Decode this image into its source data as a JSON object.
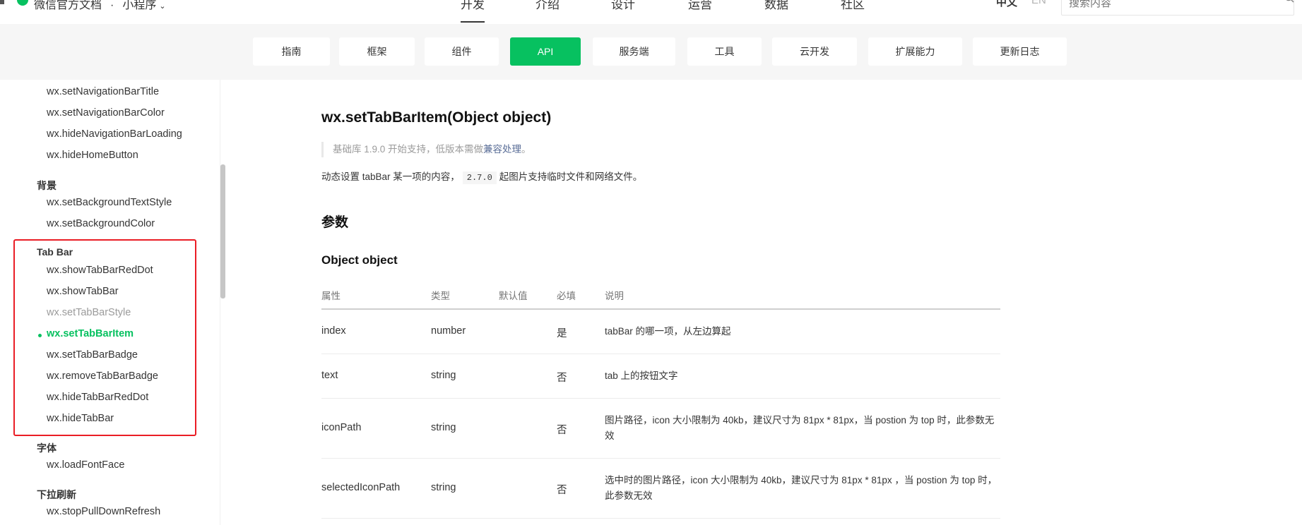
{
  "topbar": {
    "brand": "微信官方文档",
    "separator": "·",
    "product": "小程序",
    "nav": [
      "开发",
      "介绍",
      "设计",
      "运营",
      "数据",
      "社区"
    ],
    "active_nav": "开发",
    "lang_zh": "中文",
    "lang_en": "EN",
    "search_placeholder": "搜索内容"
  },
  "subnav": {
    "items": [
      "指南",
      "框架",
      "组件",
      "API",
      "服务端",
      "工具",
      "云开发",
      "扩展能力",
      "更新日志"
    ],
    "active": "API"
  },
  "sidebar": {
    "items_top": [
      "wx.setNavigationBarTitle",
      "wx.setNavigationBarColor",
      "wx.hideNavigationBarLoading",
      "wx.hideHomeButton"
    ],
    "group_bg": "背景",
    "items_bg": [
      "wx.setBackgroundTextStyle",
      "wx.setBackgroundColor"
    ],
    "group_tabbar": "Tab Bar",
    "items_tabbar": [
      "wx.showTabBarRedDot",
      "wx.showTabBar",
      "wx.setTabBarStyle",
      "wx.setTabBarItem",
      "wx.setTabBarBadge",
      "wx.removeTabBarBadge",
      "wx.hideTabBarRedDot",
      "wx.hideTabBar"
    ],
    "group_font": "字体",
    "items_font": [
      "wx.loadFontFace"
    ],
    "group_pull": "下拉刷新",
    "items_pull": [
      "wx.stopPullDownRefresh"
    ]
  },
  "content": {
    "title": "wx.setTabBarItem(Object object)",
    "support_prefix": "基础库 1.9.0 开始支持，低版本需做",
    "support_link": "兼容处理",
    "support_suffix": "。",
    "desc_prefix": "动态设置 tabBar 某一项的内容，",
    "desc_code": "2.7.0",
    "desc_suffix": "起图片支持临时文件和网络文件。",
    "params_heading": "参数",
    "object_heading": "Object object",
    "table": {
      "headers": [
        "属性",
        "类型",
        "默认值",
        "必填",
        "说明"
      ],
      "rows": [
        {
          "name": "index",
          "type": "number",
          "default": "",
          "required": "是",
          "desc": "tabBar 的哪一项，从左边算起"
        },
        {
          "name": "text",
          "type": "string",
          "default": "",
          "required": "否",
          "desc": "tab 上的按钮文字"
        },
        {
          "name": "iconPath",
          "type": "string",
          "default": "",
          "required": "否",
          "desc": "图片路径，icon 大小限制为 40kb，建议尺寸为 81px * 81px，当 postion 为 top 时，此参数无效"
        },
        {
          "name": "selectedIconPath",
          "type": "string",
          "default": "",
          "required": "否",
          "desc": "选中时的图片路径，icon 大小限制为 40kb，建议尺寸为 81px * 81px ，当 postion 为 top 时，此参数无效"
        }
      ]
    }
  },
  "colors": {
    "accent": "#07c160",
    "highlight_box": "#ea1d25",
    "link": "#576b95"
  }
}
